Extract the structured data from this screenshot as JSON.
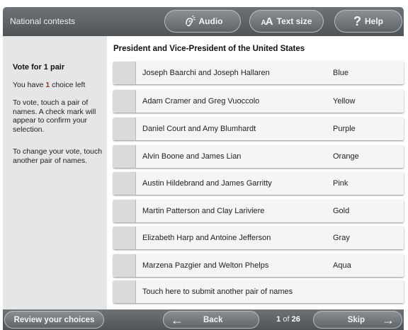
{
  "header": {
    "title": "National contests",
    "audio_label": "Audio",
    "text_size_label": "Text size",
    "text_size_small": "A",
    "text_size_big": "A",
    "help_label": "Help",
    "help_glyph": "?"
  },
  "sidebar": {
    "heading": "Vote for 1 pair",
    "choices_prefix": "You have ",
    "choices_count": "1",
    "choices_suffix": " choice left",
    "instruction_1": "To vote, touch a pair of names. A check mark will appear to confirm your selection.",
    "instruction_2": "To change your vote, touch another pair of names."
  },
  "contest": {
    "title": "President and Vice-President of the United States",
    "candidates": [
      {
        "names": "Joseph Baarchi and Joseph Hallaren",
        "party": "Blue"
      },
      {
        "names": "Adam Cramer and Greg Vuoccolo",
        "party": "Yellow"
      },
      {
        "names": "Daniel Court and Amy Blumhardt",
        "party": "Purple"
      },
      {
        "names": "Alvin Boone and James Lian",
        "party": "Orange"
      },
      {
        "names": "Austin Hildebrand and James Garritty",
        "party": "Pink"
      },
      {
        "names": "Martin Patterson and Clay Lariviere",
        "party": "Gold"
      },
      {
        "names": "Elizabeth Harp and Antoine Jefferson",
        "party": "Gray"
      },
      {
        "names": "Marzena Pazgier and Welton Phelps",
        "party": "Aqua"
      }
    ],
    "write_in_label": "Touch here to submit another pair of names"
  },
  "footer": {
    "review_label": "Review your choices",
    "back_label": "Back",
    "back_arrow": "←",
    "page_current": "1",
    "page_of": " of ",
    "page_total": "26",
    "skip_label": "Skip",
    "skip_arrow": "→"
  },
  "colors": {
    "bar_gradient_top": "#6e7377",
    "bar_gradient_bottom": "#4f5458",
    "sidebar_bg": "#e4e6e8",
    "choices_count_red": "#d0201f",
    "row_bg": "#f4f5f6",
    "checkbox_bg": "#d8dadc"
  }
}
